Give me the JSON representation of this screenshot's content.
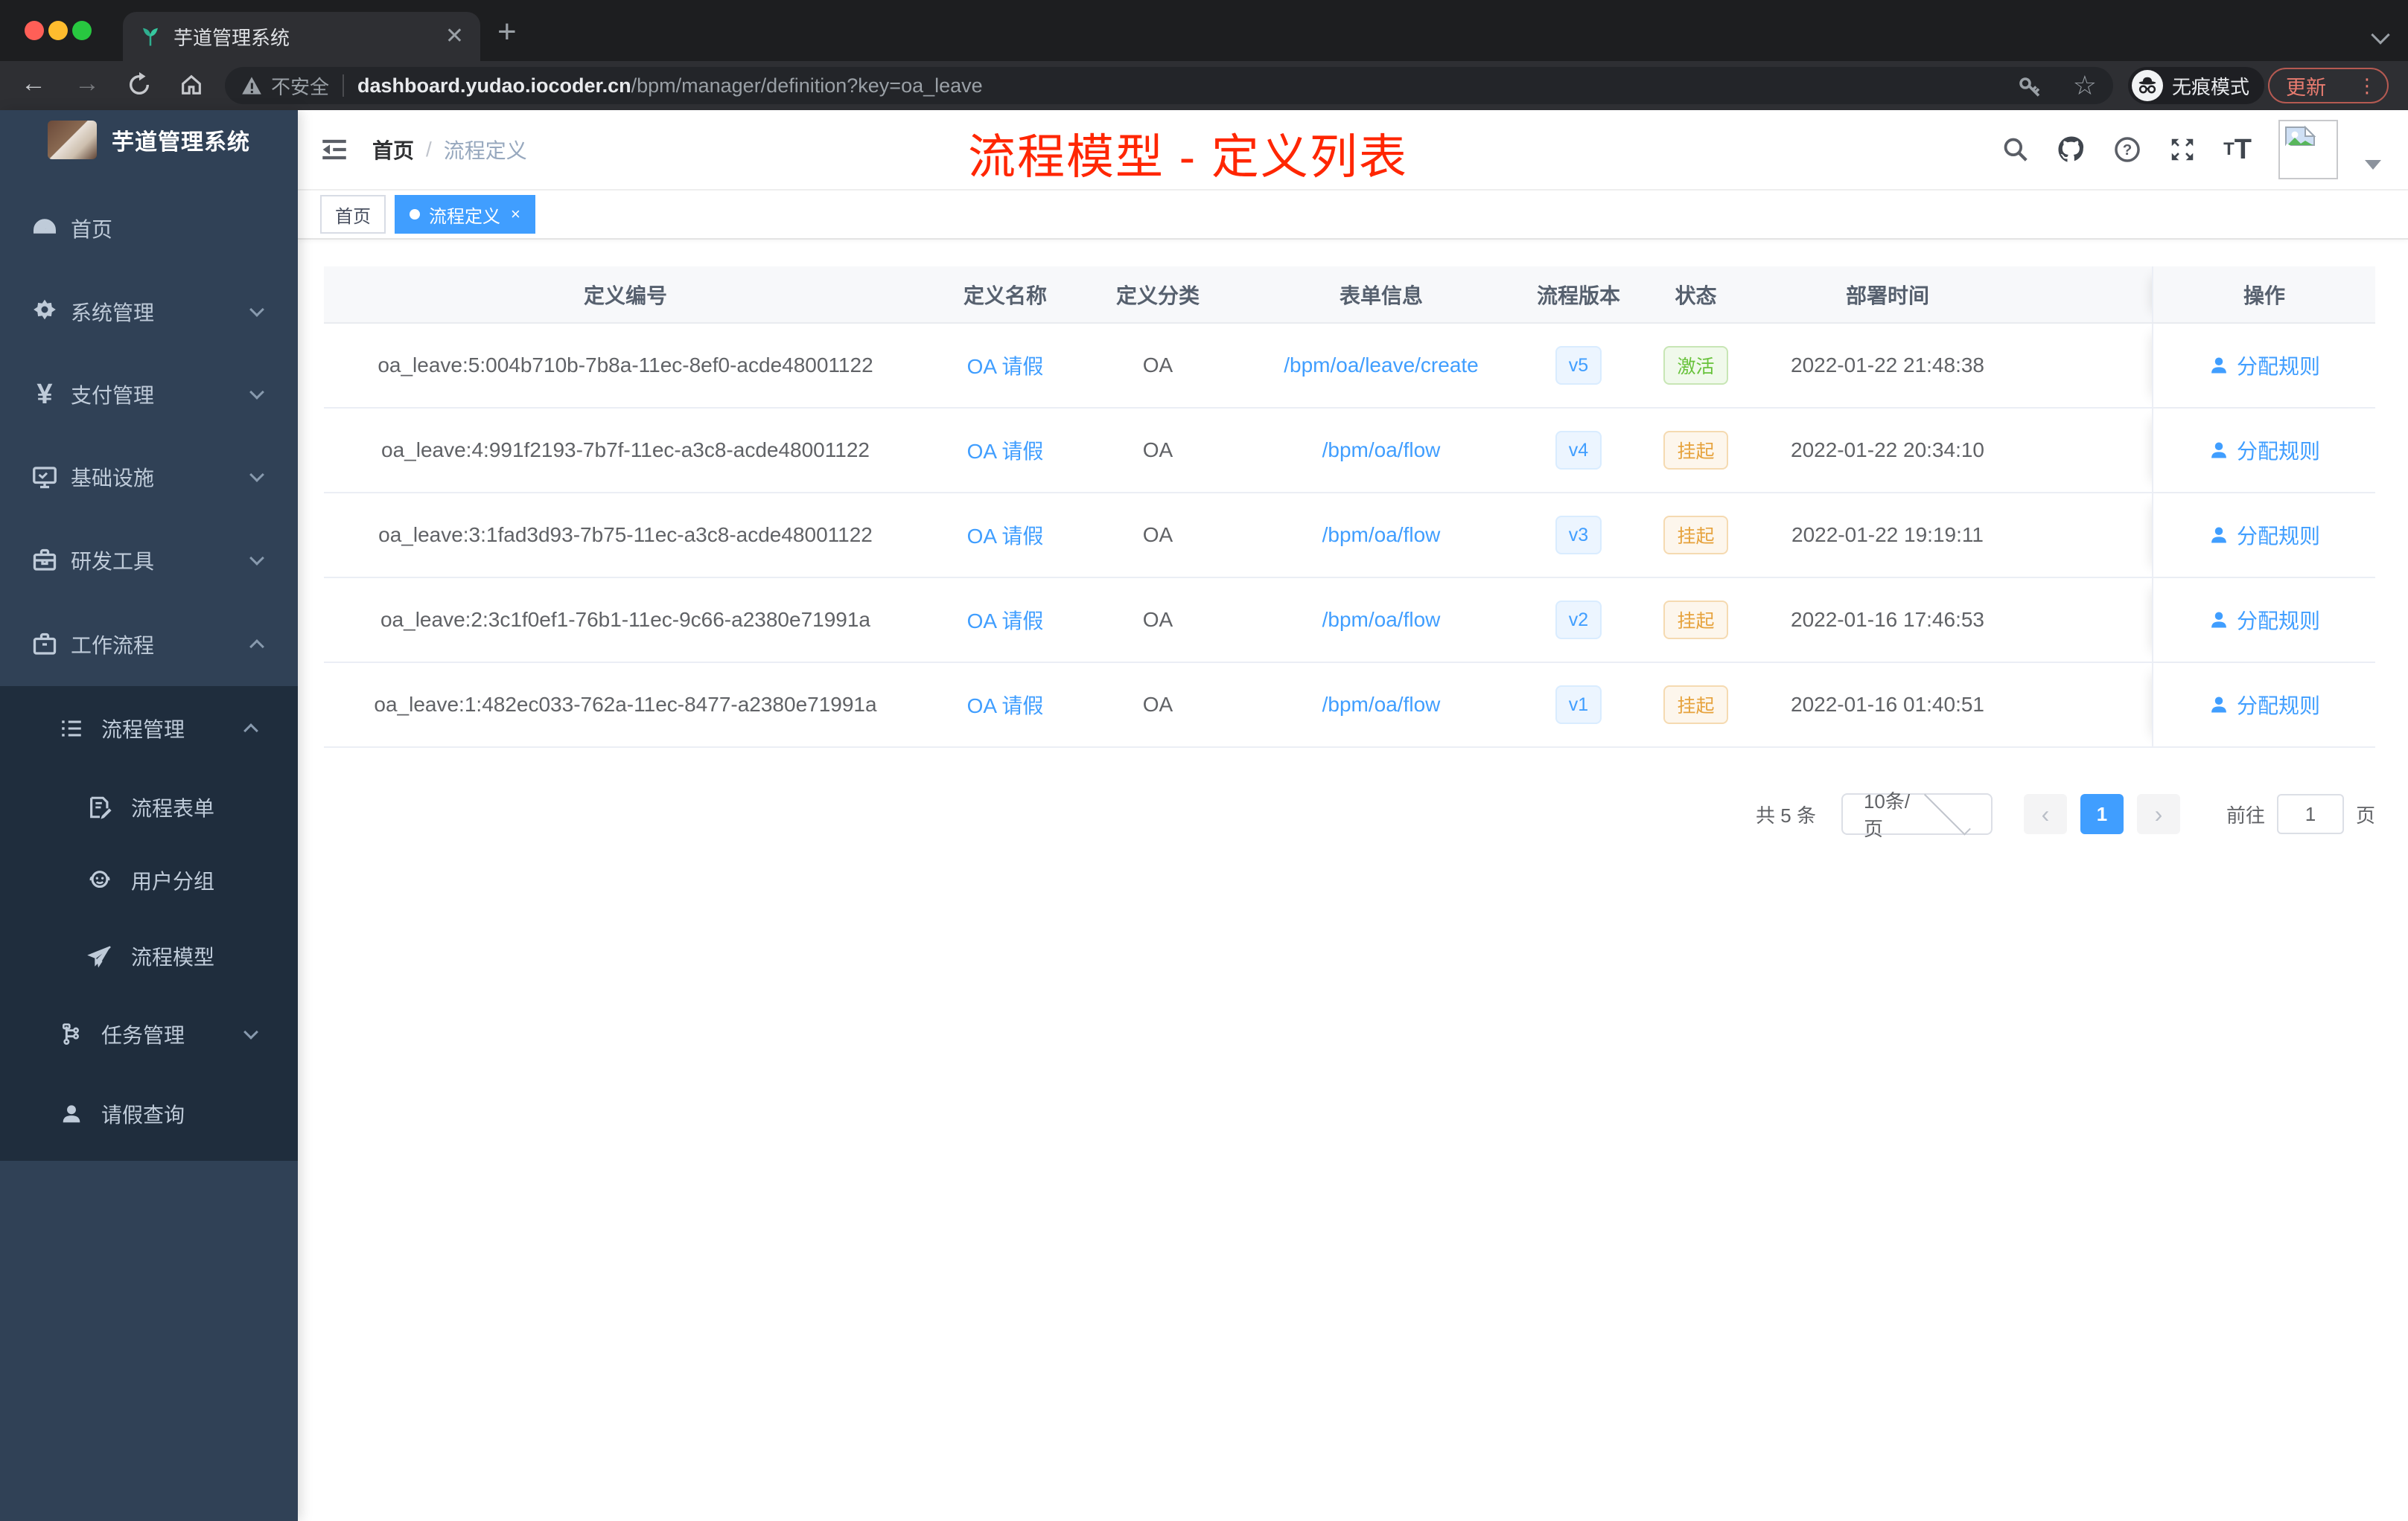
{
  "browser": {
    "tab_title": "芋道管理系统",
    "tab_close": "✕",
    "new_tab": "+",
    "back": "←",
    "forward": "→",
    "security": "不安全",
    "url_host": "dashboard.yudao.iocoder.cn",
    "url_path": "/bpm/manager/definition?key=oa_leave",
    "star": "☆",
    "incognito": "无痕模式",
    "update": "更新",
    "menu_dots": "⋮"
  },
  "sidebar": {
    "logo_title": "芋道管理系统",
    "items": [
      {
        "label": "首页"
      },
      {
        "label": "系统管理"
      },
      {
        "label": "支付管理"
      },
      {
        "label": "基础设施"
      },
      {
        "label": "研发工具"
      },
      {
        "label": "工作流程"
      },
      {
        "label": "流程管理"
      },
      {
        "label": "流程表单"
      },
      {
        "label": "用户分组"
      },
      {
        "label": "流程模型"
      },
      {
        "label": "任务管理"
      },
      {
        "label": "请假查询"
      }
    ]
  },
  "header": {
    "breadcrumb_home": "首页",
    "breadcrumb_separator": "/",
    "breadcrumb_current": "流程定义"
  },
  "annotation": "流程模型 - 定义列表",
  "tags": {
    "home": "首页",
    "active": "流程定义",
    "close": "×"
  },
  "table": {
    "columns": [
      "定义编号",
      "定义名称",
      "定义分类",
      "表单信息",
      "流程版本",
      "状态",
      "部署时间",
      "操作"
    ],
    "rows": [
      {
        "id": "oa_leave:5:004b710b-7b8a-11ec-8ef0-acde48001122",
        "name": "OA 请假",
        "category": "OA",
        "form": "/bpm/oa/leave/create",
        "version": "v5",
        "status": "激活",
        "status_class": "badge st-green",
        "time": "2022-01-22 21:48:38",
        "action": "分配规则"
      },
      {
        "id": "oa_leave:4:991f2193-7b7f-11ec-a3c8-acde48001122",
        "name": "OA 请假",
        "category": "OA",
        "form": "/bpm/oa/flow",
        "version": "v4",
        "status": "挂起",
        "status_class": "badge st-orange",
        "time": "2022-01-22 20:34:10",
        "action": "分配规则"
      },
      {
        "id": "oa_leave:3:1fad3d93-7b75-11ec-a3c8-acde48001122",
        "name": "OA 请假",
        "category": "OA",
        "form": "/bpm/oa/flow",
        "version": "v3",
        "status": "挂起",
        "status_class": "badge st-orange",
        "time": "2022-01-22 19:19:11",
        "action": "分配规则"
      },
      {
        "id": "oa_leave:2:3c1f0ef1-76b1-11ec-9c66-a2380e71991a",
        "name": "OA 请假",
        "category": "OA",
        "form": "/bpm/oa/flow",
        "version": "v2",
        "status": "挂起",
        "status_class": "badge st-orange",
        "time": "2022-01-16 17:46:53",
        "action": "分配规则"
      },
      {
        "id": "oa_leave:1:482ec033-762a-11ec-8477-a2380e71991a",
        "name": "OA 请假",
        "category": "OA",
        "form": "/bpm/oa/flow",
        "version": "v1",
        "status": "挂起",
        "status_class": "badge st-orange",
        "time": "2022-01-16 01:40:51",
        "action": "分配规则"
      }
    ]
  },
  "pagination": {
    "total": "共 5 条",
    "page_size": "10条/页",
    "prev": "‹",
    "next": "›",
    "page": "1",
    "goto": "前往",
    "goto_value": "1",
    "unit": "页"
  }
}
